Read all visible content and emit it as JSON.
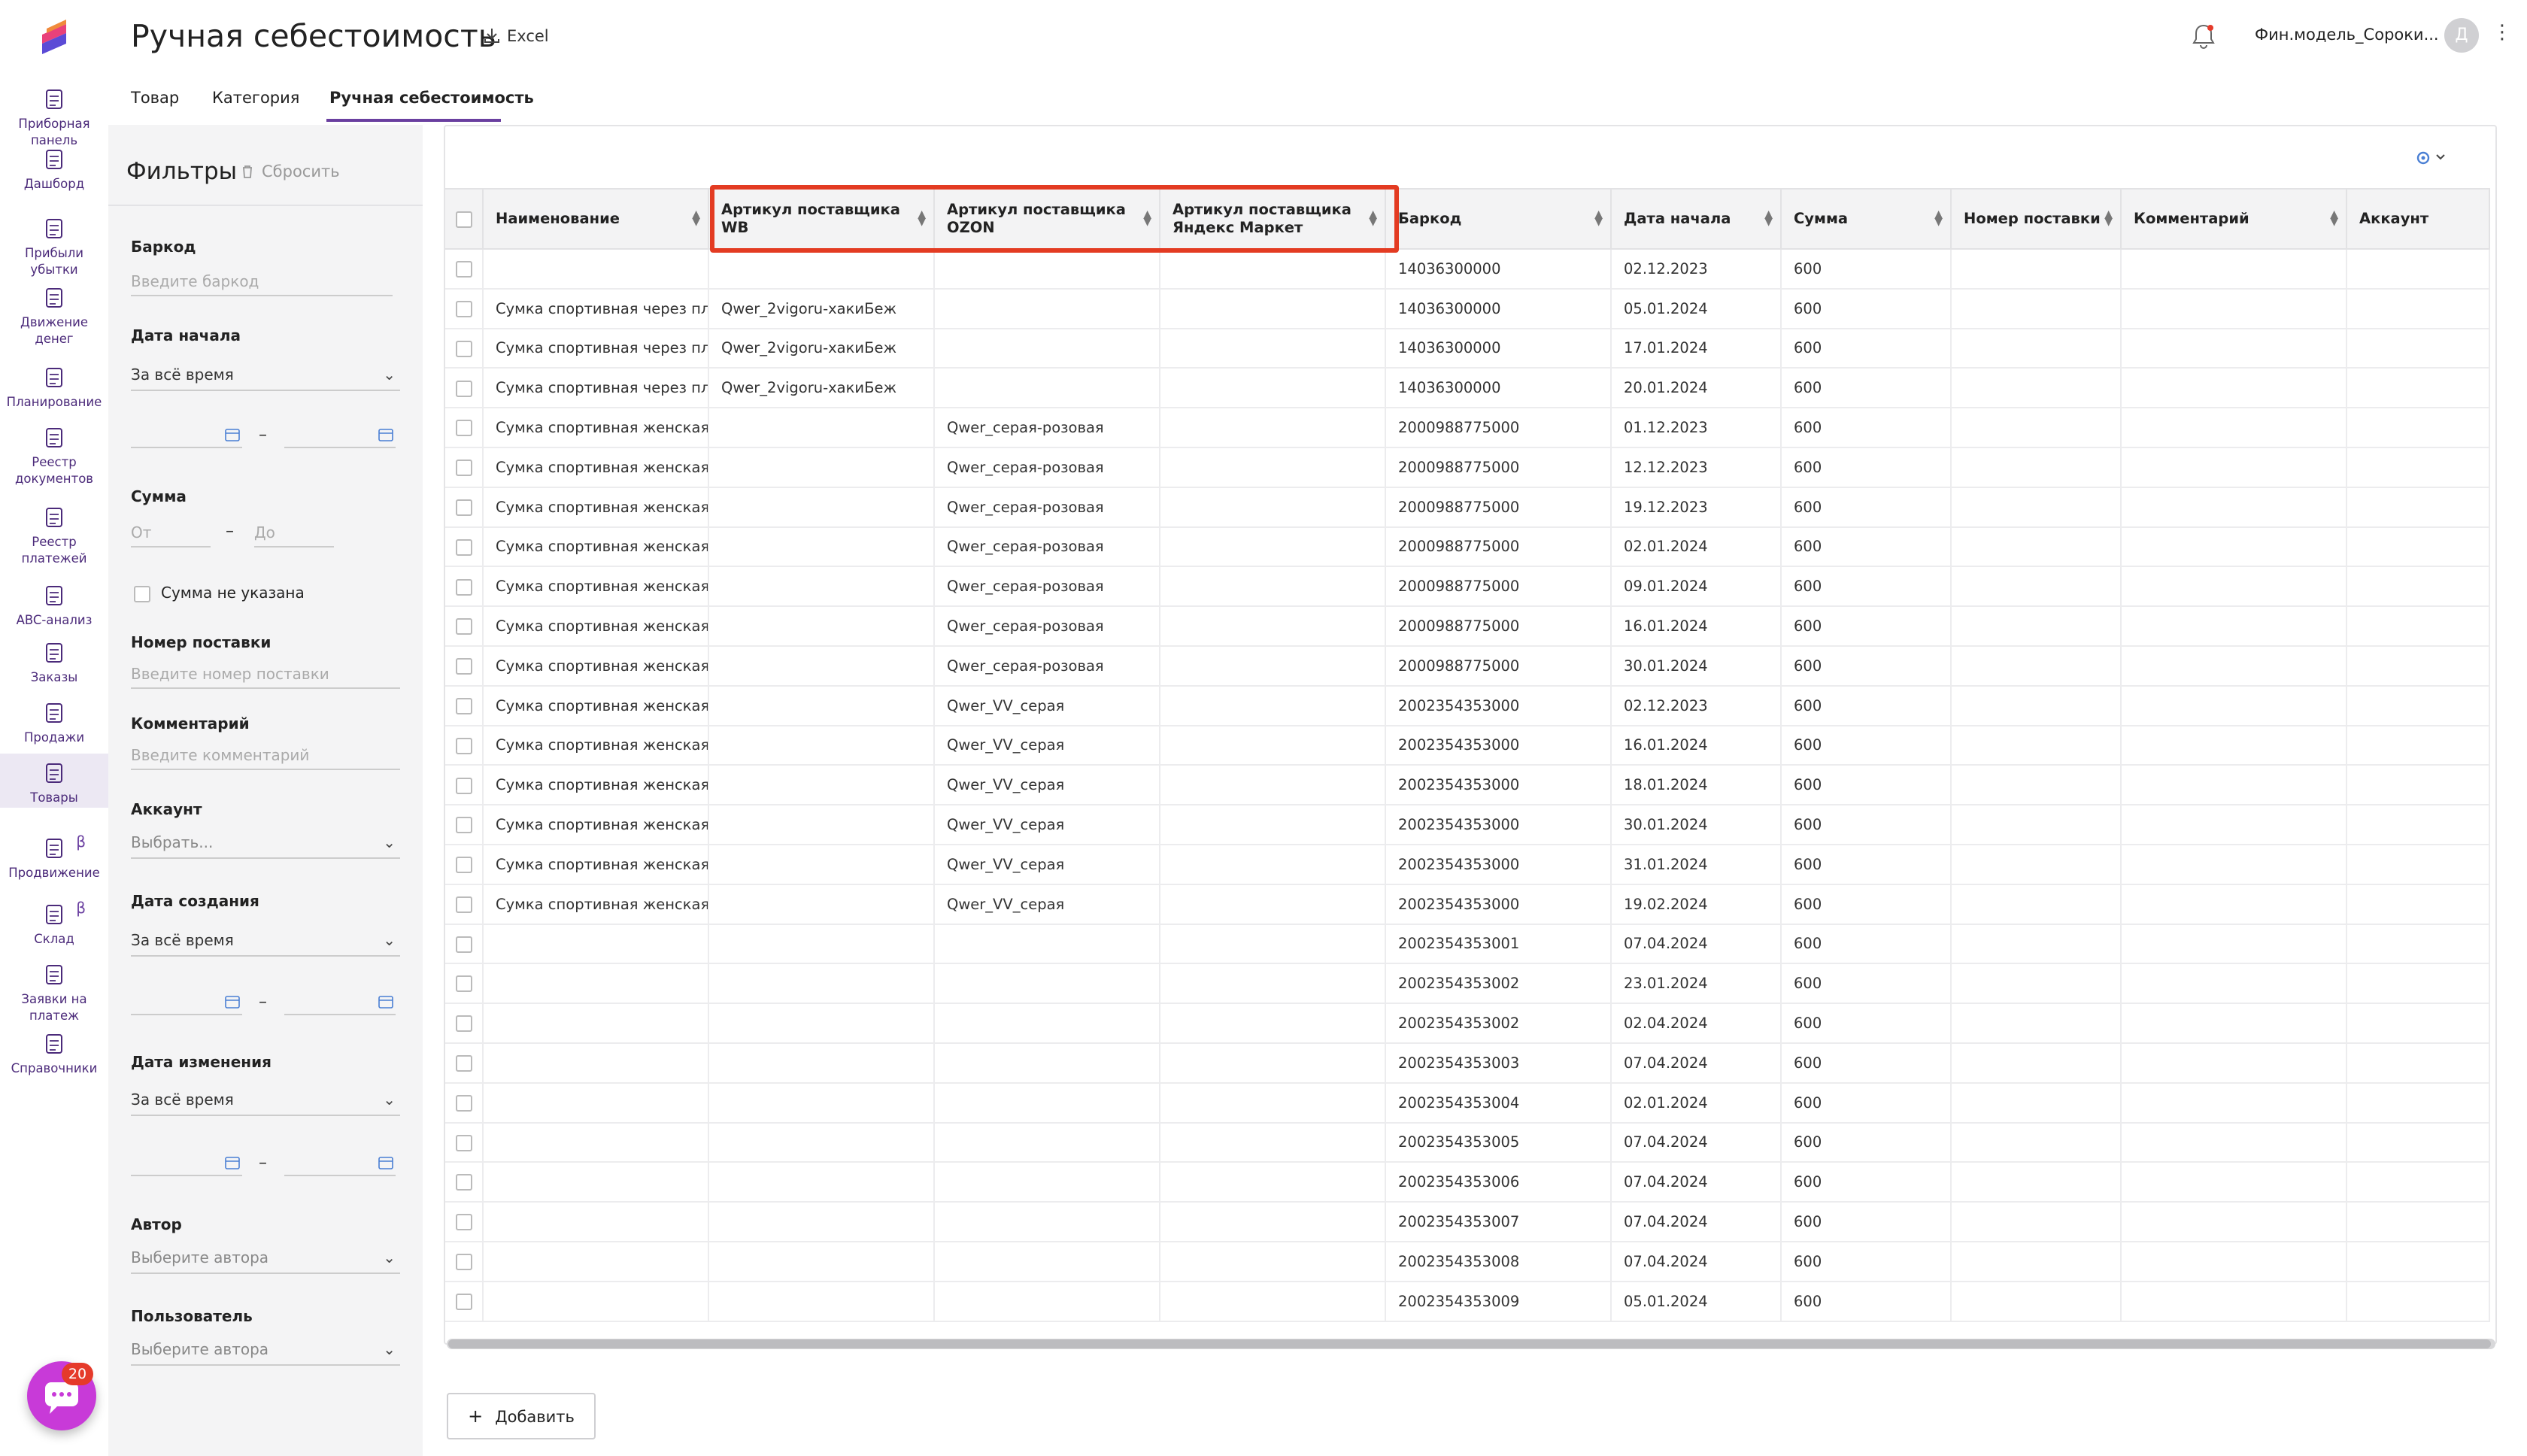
{
  "header": {
    "title": "Ручная себестоимость",
    "excel_label": "Excel",
    "user_name": "Фин.модель_Сороки...",
    "avatar_initial": "Д",
    "kebab": "⋮"
  },
  "tabs": [
    {
      "label": "Товар"
    },
    {
      "label": "Категория"
    },
    {
      "label": "Ручная себестоимость",
      "active": true
    }
  ],
  "nav": {
    "items": [
      {
        "label": "Приборная панель",
        "icon": "dashboard-panel-icon"
      },
      {
        "label": "Дашборд",
        "icon": "pie-chart-icon"
      },
      {
        "label": "Прибыли убытки",
        "icon": "bar-chart-icon"
      },
      {
        "label": "Движение денег",
        "icon": "money-flow-icon"
      },
      {
        "label": "Планирование",
        "icon": "target-icon"
      },
      {
        "label": "Реестр документов",
        "icon": "documents-icon"
      },
      {
        "label": "Реестр платежей",
        "icon": "wallet-icon"
      },
      {
        "label": "ABC-анализ",
        "icon": "abc-icon"
      },
      {
        "label": "Заказы",
        "icon": "shopping-bag-icon"
      },
      {
        "label": "Продажи",
        "icon": "dollar-icon"
      },
      {
        "label": "Товары",
        "icon": "boxes-icon",
        "active": true
      },
      {
        "label": "Продвижение",
        "icon": "megaphone-icon",
        "beta": "β"
      },
      {
        "label": "Склад",
        "icon": "warehouse-icon",
        "beta": "β"
      },
      {
        "label": "Заявки на платеж",
        "icon": "payment-request-icon"
      },
      {
        "label": "Справочники",
        "icon": "folder-icon"
      }
    ],
    "chat_badge": "20"
  },
  "filters": {
    "title": "Фильтры",
    "reset_label": "Сбросить",
    "barcode_label": "Баркод",
    "barcode_placeholder": "Введите баркод",
    "start_date_label": "Дата начала",
    "start_date_value": "За всё время",
    "sum_label": "Сумма",
    "sum_from": "От",
    "sum_to": "До",
    "sum_none_label": "Сумма не указана",
    "supply_label": "Номер поставки",
    "supply_placeholder": "Введите номер поставки",
    "comment_label": "Комментарий",
    "comment_placeholder": "Введите комментарий",
    "account_label": "Аккаунт",
    "account_value": "Выбрать...",
    "created_label": "Дата создания",
    "created_value": "За всё время",
    "modified_label": "Дата изменения",
    "modified_value": "За всё время",
    "author_label": "Автор",
    "author_placeholder": "Выберите автора",
    "user_label": "Пользователь",
    "user_placeholder": "Выберите автора",
    "range_dash": "–"
  },
  "table": {
    "columns": [
      "Наименование",
      "Артикул поставщика WB",
      "Артикул поставщика OZON",
      "Артикул поставщика Яндекс Маркет",
      "Баркод",
      "Дата начала",
      "Сумма",
      "Номер поставки",
      "Комментарий",
      "Аккаунт"
    ],
    "rows": [
      [
        "",
        "",
        "",
        "",
        "14036300000",
        "02.12.2023",
        "600",
        "",
        "",
        ""
      ],
      [
        "Сумка спортивная через плеч",
        "Qwer_2vigoru-хакиБеж",
        "",
        "",
        "14036300000",
        "05.01.2024",
        "600",
        "",
        "",
        ""
      ],
      [
        "Сумка спортивная через плеч",
        "Qwer_2vigoru-хакиБеж",
        "",
        "",
        "14036300000",
        "17.01.2024",
        "600",
        "",
        "",
        ""
      ],
      [
        "Сумка спортивная через плеч",
        "Qwer_2vigoru-хакиБеж",
        "",
        "",
        "14036300000",
        "20.01.2024",
        "600",
        "",
        "",
        ""
      ],
      [
        "Сумка спортивная женская, С",
        "",
        "Qwer_серая-розовая",
        "",
        "2000988775000",
        "01.12.2023",
        "600",
        "",
        "",
        ""
      ],
      [
        "Сумка спортивная женская, С",
        "",
        "Qwer_серая-розовая",
        "",
        "2000988775000",
        "12.12.2023",
        "600",
        "",
        "",
        ""
      ],
      [
        "Сумка спортивная женская, С",
        "",
        "Qwer_серая-розовая",
        "",
        "2000988775000",
        "19.12.2023",
        "600",
        "",
        "",
        ""
      ],
      [
        "Сумка спортивная женская, С",
        "",
        "Qwer_серая-розовая",
        "",
        "2000988775000",
        "02.01.2024",
        "600",
        "",
        "",
        ""
      ],
      [
        "Сумка спортивная женская, С",
        "",
        "Qwer_серая-розовая",
        "",
        "2000988775000",
        "09.01.2024",
        "600",
        "",
        "",
        ""
      ],
      [
        "Сумка спортивная женская, С",
        "",
        "Qwer_серая-розовая",
        "",
        "2000988775000",
        "16.01.2024",
        "600",
        "",
        "",
        ""
      ],
      [
        "Сумка спортивная женская, С",
        "",
        "Qwer_серая-розовая",
        "",
        "2000988775000",
        "30.01.2024",
        "600",
        "",
        "",
        ""
      ],
      [
        "Сумка спортивная женская,Q",
        "",
        "Qwer_VV_серая",
        "",
        "2002354353000",
        "02.12.2023",
        "600",
        "",
        "",
        ""
      ],
      [
        "Сумка спортивная женская,Q",
        "",
        "Qwer_VV_серая",
        "",
        "2002354353000",
        "16.01.2024",
        "600",
        "",
        "",
        ""
      ],
      [
        "Сумка спортивная женская,Q",
        "",
        "Qwer_VV_серая",
        "",
        "2002354353000",
        "18.01.2024",
        "600",
        "",
        "",
        ""
      ],
      [
        "Сумка спортивная женская,Q",
        "",
        "Qwer_VV_серая",
        "",
        "2002354353000",
        "30.01.2024",
        "600",
        "",
        "",
        ""
      ],
      [
        "Сумка спортивная женская,Q",
        "",
        "Qwer_VV_серая",
        "",
        "2002354353000",
        "31.01.2024",
        "600",
        "",
        "",
        ""
      ],
      [
        "Сумка спортивная женская,Q",
        "",
        "Qwer_VV_серая",
        "",
        "2002354353000",
        "19.02.2024",
        "600",
        "",
        "",
        ""
      ],
      [
        "",
        "",
        "",
        "",
        "2002354353001",
        "07.04.2024",
        "600",
        "",
        "",
        ""
      ],
      [
        "",
        "",
        "",
        "",
        "2002354353002",
        "23.01.2024",
        "600",
        "",
        "",
        ""
      ],
      [
        "",
        "",
        "",
        "",
        "2002354353002",
        "02.04.2024",
        "600",
        "",
        "",
        ""
      ],
      [
        "",
        "",
        "",
        "",
        "2002354353003",
        "07.04.2024",
        "600",
        "",
        "",
        ""
      ],
      [
        "",
        "",
        "",
        "",
        "2002354353004",
        "02.01.2024",
        "600",
        "",
        "",
        ""
      ],
      [
        "",
        "",
        "",
        "",
        "2002354353005",
        "07.04.2024",
        "600",
        "",
        "",
        ""
      ],
      [
        "",
        "",
        "",
        "",
        "2002354353006",
        "07.04.2024",
        "600",
        "",
        "",
        ""
      ],
      [
        "",
        "",
        "",
        "",
        "2002354353007",
        "07.04.2024",
        "600",
        "",
        "",
        ""
      ],
      [
        "",
        "",
        "",
        "",
        "2002354353008",
        "07.04.2024",
        "600",
        "",
        "",
        ""
      ],
      [
        "",
        "",
        "",
        "",
        "2002354353009",
        "05.01.2024",
        "600",
        "",
        "",
        ""
      ]
    ],
    "add_label": "Добавить",
    "add_plus": "+"
  },
  "colors": {
    "accent": "#6a3fa0",
    "highlight": "#e33b22",
    "chat": "#c83ad8"
  }
}
